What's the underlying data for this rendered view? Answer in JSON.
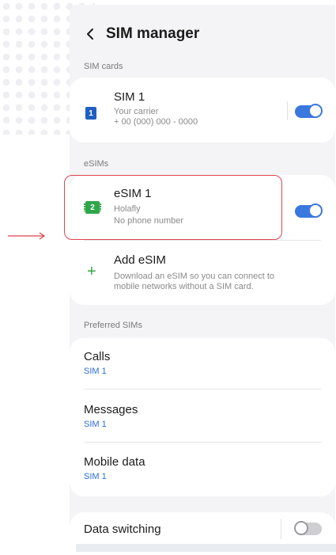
{
  "header": {
    "title": "SIM manager"
  },
  "sections": {
    "sim_cards": "SIM cards",
    "esims": "eSIMs",
    "preferred": "Preferred SIMs"
  },
  "sim1": {
    "badge": "1",
    "title": "SIM 1",
    "carrier": "Your carrier",
    "number": "+ 00 (000) 000 - 0000",
    "enabled": true
  },
  "esim1": {
    "badge": "2",
    "title": "eSIM 1",
    "carrier": "Holafly",
    "number": "No phone number",
    "enabled": true
  },
  "add_esim": {
    "icon": "+",
    "title": "Add eSIM",
    "desc_line1": "Download an eSIM so you can connect to",
    "desc_line2": "mobile networks without a SIM card."
  },
  "preferred": {
    "calls": {
      "label": "Calls",
      "value": "SIM 1"
    },
    "messages": {
      "label": "Messages",
      "value": "SIM 1"
    },
    "mobile_data": {
      "label": "Mobile data",
      "value": "SIM 1"
    }
  },
  "data_switching": {
    "label": "Data switching",
    "enabled": false
  },
  "colors": {
    "accent": "#3a78e0",
    "highlight": "#e0444d",
    "esim_green": "#2fa64a"
  }
}
